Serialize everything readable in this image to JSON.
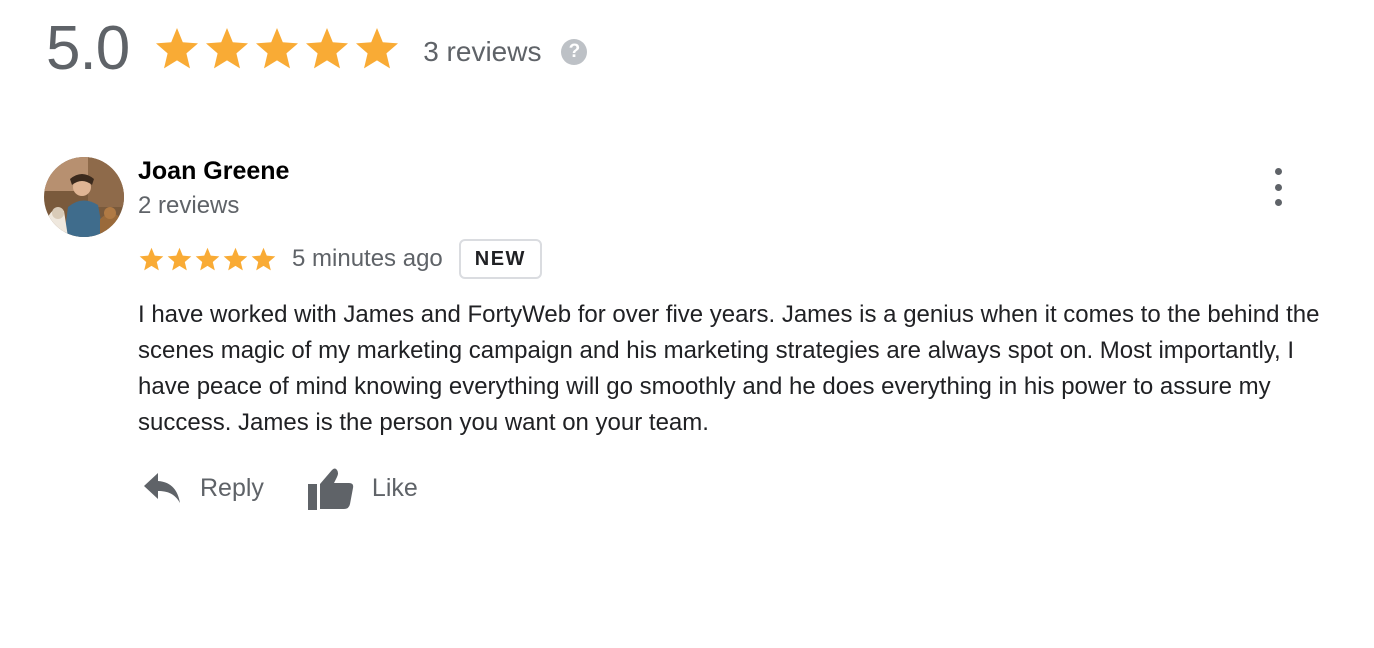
{
  "summary": {
    "score": "5.0",
    "stars": 5,
    "count_label": "3 reviews",
    "help_glyph": "?"
  },
  "colors": {
    "star": "#f9ab35",
    "muted_text": "#5f6368",
    "badge_border": "#dadce0"
  },
  "review": {
    "author": "Joan Greene",
    "author_reviews": "2 reviews",
    "stars": 5,
    "time": "5 minutes ago",
    "badge": "NEW",
    "text": "I have worked with James and FortyWeb for over five years.  James is a genius when it comes to the behind the scenes magic of my marketing campaign and his marketing strategies are always spot on. Most importantly, I have peace of mind knowing everything will go smoothly and he does everything in his power to assure my success. James is the person you want on your team.",
    "avatar_icon": "avatar-photo",
    "menu_icon": "more-vert-icon"
  },
  "actions": {
    "reply_label": "Reply",
    "reply_icon": "reply-icon",
    "like_label": "Like",
    "like_icon": "thumb-up-icon"
  }
}
